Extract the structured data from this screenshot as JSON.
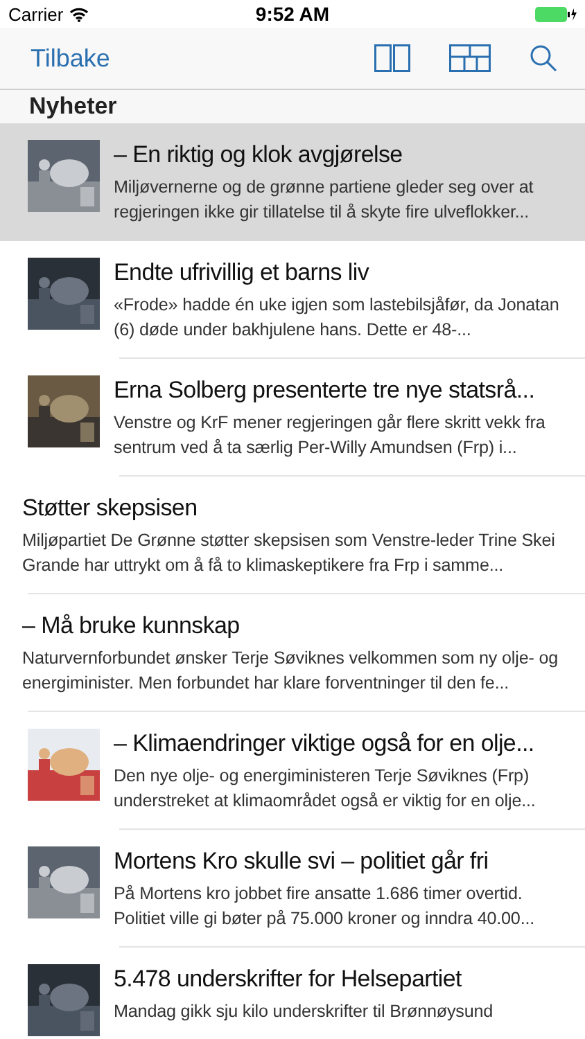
{
  "status_bar": {
    "carrier": "Carrier",
    "time": "9:52 AM"
  },
  "nav_bar": {
    "back": "Tilbake"
  },
  "section": {
    "title": "Nyheter"
  },
  "articles": [
    {
      "kind": "picture",
      "selected": true,
      "title": "– En riktig og klok avgjørelse",
      "summary": "Miljøvernerne og de grønne partiene gleder seg over at regjeringen ikke gir tillatelse til å skyte fire ulveflokker..."
    },
    {
      "kind": "picture",
      "selected": false,
      "title": "Endte ufrivillig et barns liv",
      "summary": "«Frode» hadde én uke igjen som lastebilsjåfør, da Jonatan (6) døde under bakhjulene hans. Dette er 48-..."
    },
    {
      "kind": "picture",
      "selected": false,
      "title": "Erna Solberg presenterte tre nye statsrå...",
      "summary": "Venstre og KrF mener regjeringen går flere skritt vekk fra sentrum ved å ta særlig Per-Willy Amundsen (Frp) i..."
    },
    {
      "kind": "text",
      "selected": false,
      "title": "Støtter skepsisen",
      "summary": "Miljøpartiet De Grønne støtter skepsisen som Venstre-leder Trine Skei Grande har uttrykt om å få to klimaskeptikere fra Frp i samme..."
    },
    {
      "kind": "text",
      "selected": false,
      "title": "– Må bruke kunnskap",
      "summary": "Naturvernforbundet ønsker Terje Søviknes velkommen som ny olje- og energiminister. Men forbundet har klare forventninger til den fe..."
    },
    {
      "kind": "picture",
      "selected": false,
      "title": "– Klimaendringer viktige også for en olje...",
      "summary": "Den nye olje- og energiministeren Terje Søviknes (Frp) understreket at klimaområdet også er viktig for en olje..."
    },
    {
      "kind": "picture",
      "selected": false,
      "title": "Mortens Kro skulle svi – politiet går fri",
      "summary": "På Mortens kro jobbet fire ansatte 1.686 timer overtid. Politiet ville gi bøter på 75.000 kroner og inndra 40.00..."
    },
    {
      "kind": "picture",
      "selected": false,
      "title": "5.478 underskrifter for Helsepartiet",
      "summary": "Mandag gikk sju kilo underskrifter til Brønnøysund"
    }
  ]
}
